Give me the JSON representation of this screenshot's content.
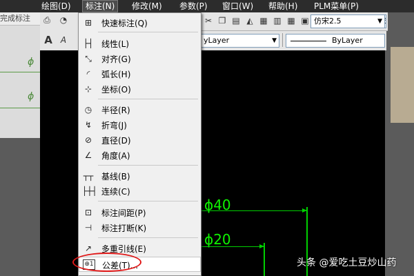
{
  "menubar": {
    "items": [
      {
        "label": "绘图(D)"
      },
      {
        "label": "标注(N)"
      },
      {
        "label": "修改(M)"
      },
      {
        "label": "参数(P)"
      },
      {
        "label": "窗口(W)"
      },
      {
        "label": "帮助(H)"
      },
      {
        "label": "PLM菜单(P)"
      }
    ]
  },
  "left_panel": {
    "tab_text": "完成标注",
    "phi": "ϕ"
  },
  "toolbar": {
    "text_style": "仿宋2.5",
    "layer_combo": "yLayer",
    "linetype_combo": "ByLayer",
    "help_glyph": "?"
  },
  "dimension_menu": {
    "items": [
      {
        "label": "快速标注(Q)",
        "icon": "quick-dimension-icon"
      },
      {
        "label": "线性(L)",
        "icon": "linear-icon"
      },
      {
        "label": "对齐(G)",
        "icon": "aligned-icon"
      },
      {
        "label": "弧长(H)",
        "icon": "arc-length-icon"
      },
      {
        "label": "坐标(O)",
        "icon": "ordinate-icon"
      },
      {
        "label": "半径(R)",
        "icon": "radius-icon"
      },
      {
        "label": "折弯(J)",
        "icon": "jogged-icon"
      },
      {
        "label": "直径(D)",
        "icon": "diameter-icon"
      },
      {
        "label": "角度(A)",
        "icon": "angle-icon"
      },
      {
        "label": "基线(B)",
        "icon": "baseline-icon"
      },
      {
        "label": "连续(C)",
        "icon": "continue-icon"
      },
      {
        "label": "标注间距(P)",
        "icon": "dimension-space-icon"
      },
      {
        "label": "标注打断(K)",
        "icon": "dimension-break-icon"
      },
      {
        "label": "多重引线(E)",
        "icon": "multileader-icon"
      },
      {
        "label": "公差(T)...",
        "icon": "tolerance-icon"
      }
    ]
  },
  "canvas": {
    "dim1": "ϕ40",
    "dim2": "ϕ20"
  },
  "watermark": "头条 @爱吃土豆炒山药",
  "colors": {
    "highlight_ring": "#e01818",
    "dimension_green": "#0ff400",
    "canvas_bg": "#000000"
  }
}
